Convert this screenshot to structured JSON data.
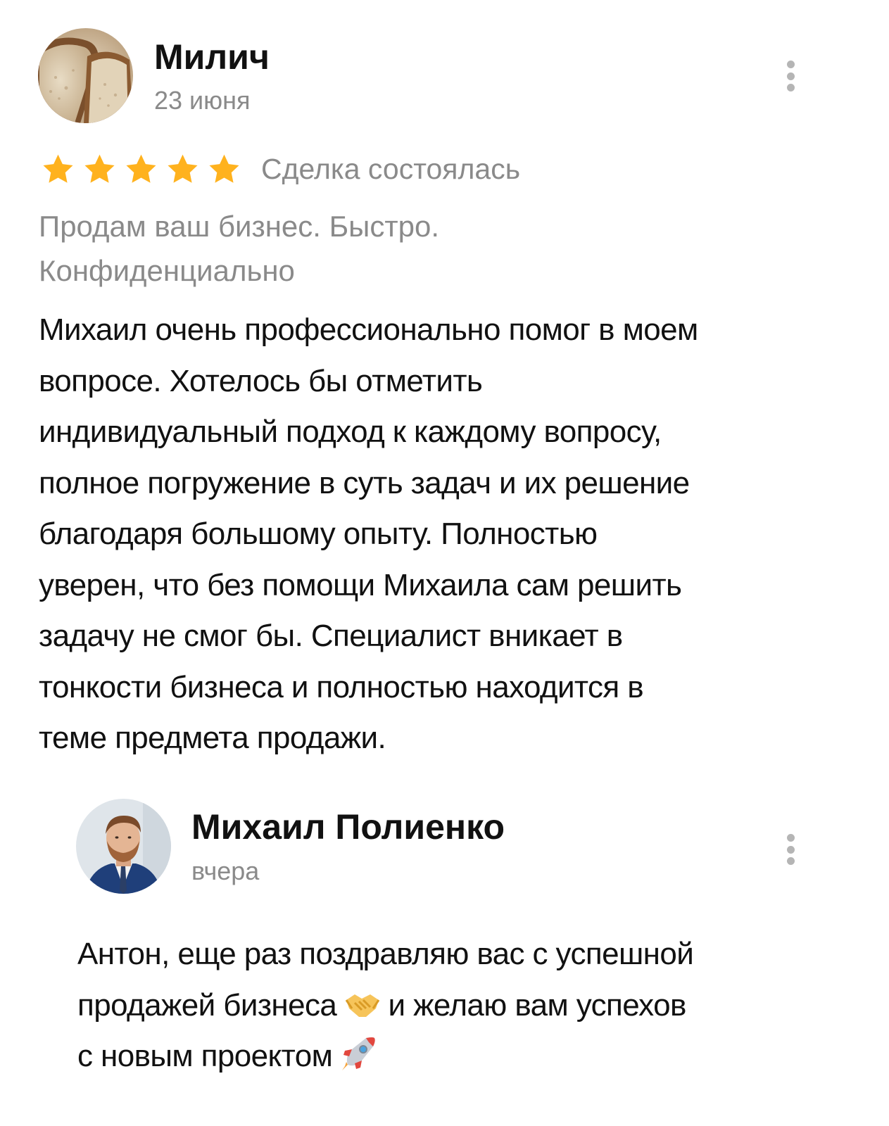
{
  "review": {
    "author": "Милич",
    "date": "23 июня",
    "avatar_icon": "bread-avatar",
    "rating": 5,
    "rating_max": 5,
    "star_color": "#FFB21E",
    "deal_status": "Сделка состоялась",
    "ad_title_line1": "Продам ваш бизнес. Быстро.",
    "ad_title_line2": "Конфиденциально",
    "text_lines": [
      "Михаил очень профессионально помог в моем",
      "вопросе. Хотелось бы отметить",
      "индивидуальный подход к каждому вопросу,",
      "полное погружение в суть задач и их решение",
      "благодаря большому опыту. Полностью",
      "уверен, что без помощи Михаила сам решить",
      "задачу не смог бы. Специалист вникает в",
      "тонкости бизнеса и полностью находится в",
      "теме предмета продажи."
    ]
  },
  "reply": {
    "author": "Михаил Полиенко",
    "date": "вчера",
    "avatar_icon": "person-photo-avatar",
    "line1": "Антон, еще раз поздравляю вас с успешной",
    "line2a": "продажей бизнеса",
    "line2_emoji": "handshake-emoji",
    "line2b": "и желаю вам успехов",
    "line3a": "с новым проектом",
    "line3_emoji": "rocket-emoji"
  }
}
